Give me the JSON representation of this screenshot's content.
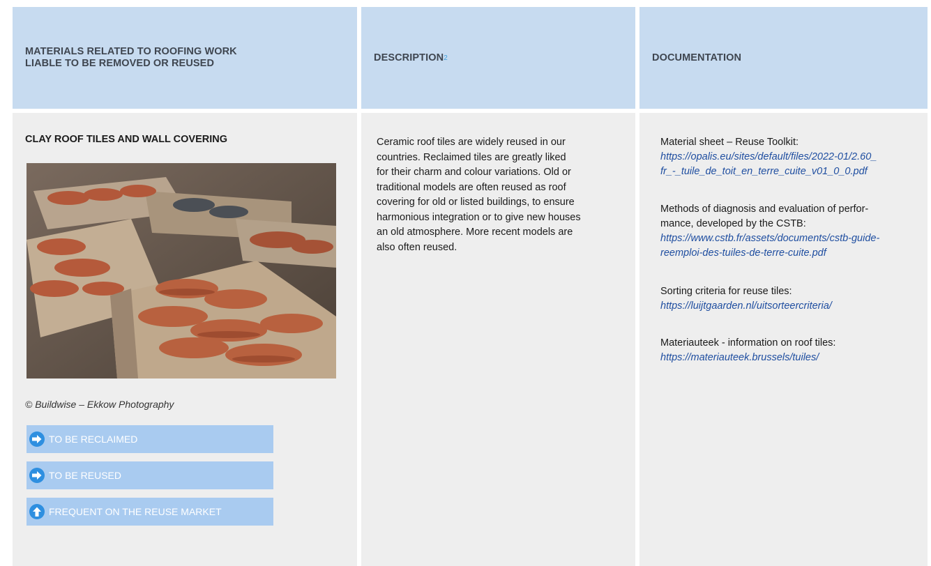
{
  "headers": {
    "col1": [
      "MATERIALS RELATED TO ROOFING WORK",
      "LIABLE TO BE REMOVED OR REUSED"
    ],
    "col2": "DESCRIPTION",
    "col2_footnote": "2",
    "col3": "DOCUMENTATION"
  },
  "item": {
    "title": "CLAY ROOF TILES AND WALL COVERING",
    "photo_credit": "© Buildwise – Ekkow Photography",
    "tags": [
      {
        "label": "TO BE RECLAIMED",
        "icon": "arrow-right-icon"
      },
      {
        "label": "TO BE REUSED",
        "icon": "arrow-right-icon"
      },
      {
        "label": "FREQUENT ON THE REUSE MARKET",
        "icon": "arrow-up-icon"
      }
    ],
    "description_lines": [
      "Ceramic roof tiles are widely reused in our",
      "countries. Reclaimed tiles are greatly liked",
      "for their charm and colour variations. Old or",
      "traditional models are often reused as roof",
      "covering for old or listed buildings, to ensure",
      "harmonious integration or to give new houses",
      "an old atmosphere. More recent models are",
      "also often reused."
    ]
  },
  "documentation": [
    {
      "label_lines": [
        "Material sheet – Reuse Toolkit:"
      ],
      "link_lines": [
        "https://opalis.eu/sites/default/files/2022-01/2.60_",
        "fr_-_tuile_de_toit_en_terre_cuite_v01_0_0.pdf"
      ]
    },
    {
      "label_lines": [
        "Methods of diagnosis and evaluation of perfor-",
        "mance, developed by the CSTB:"
      ],
      "link_lines": [
        "https://www.cstb.fr/assets/documents/cstb-guide-",
        "reemploi-des-tuiles-de-terre-cuite.pdf"
      ]
    },
    {
      "label_lines": [
        "Sorting criteria for reuse tiles:"
      ],
      "link_lines": [
        "https://luijtgaarden.nl/uitsorteercriteria/"
      ]
    },
    {
      "label_lines": [
        "Materiauteek - information on roof tiles:"
      ],
      "link_lines": [
        "https://materiauteek.brussels/tuiles/"
      ]
    }
  ],
  "colors": {
    "header_bg": "#c7dbf0",
    "body_bg": "#eeeeee",
    "tag_bg": "#a9cbf0",
    "link": "#1f4ea0",
    "icon_blue": "#2e8fe0"
  }
}
